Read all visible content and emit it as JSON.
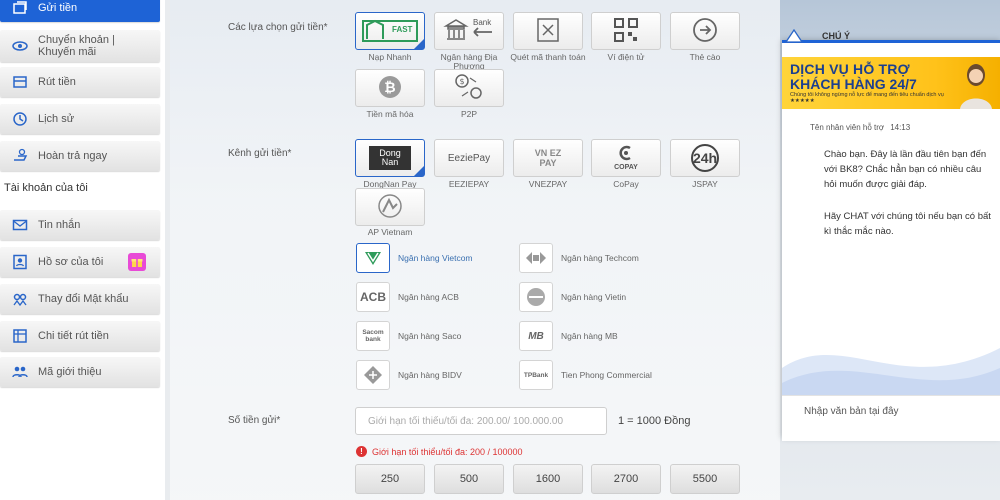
{
  "sidebar": {
    "items": [
      {
        "label": "Gửi tiền",
        "icon": "deposit-icon"
      },
      {
        "label": "Chuyển khoản | Khuyến mãi",
        "icon": "transfer-icon"
      },
      {
        "label": "Rút tiền",
        "icon": "withdraw-icon"
      },
      {
        "label": "Lịch sử",
        "icon": "history-icon"
      },
      {
        "label": "Hoàn trả ngay",
        "icon": "refund-icon"
      }
    ],
    "section_title": "Tài khoản của tôi",
    "account_items": [
      {
        "label": "Tin nhắn",
        "icon": "mail-icon"
      },
      {
        "label": "Hồ sơ của tôi",
        "icon": "profile-icon"
      },
      {
        "label": "Thay đổi Mật khẩu",
        "icon": "key-icon"
      },
      {
        "label": "Chi tiết rút tiền",
        "icon": "withdraw-details-icon"
      },
      {
        "label": "Mã giới thiệu",
        "icon": "referral-icon"
      }
    ]
  },
  "deposit": {
    "options_label": "Các lựa chọn gửi tiền*",
    "options": [
      {
        "label": "Nạp Nhanh",
        "logo": "FAST"
      },
      {
        "label": "Ngân hàng Địa Phương",
        "logo": "Bank"
      },
      {
        "label": "Quét mã thanh toán",
        "logo": ""
      },
      {
        "label": "Ví điện tử",
        "logo": ""
      },
      {
        "label": "Thẻ cào",
        "logo": ""
      },
      {
        "label": "Tiền mã hóa",
        "logo": ""
      },
      {
        "label": "P2P",
        "logo": ""
      }
    ],
    "channel_label": "Kênh gửi tiền*",
    "channels": [
      {
        "label": "DongNan Pay",
        "logo": "Dong Nan"
      },
      {
        "label": "EEZIEPAY",
        "logo": "EeziePay"
      },
      {
        "label": "VNEZPAY",
        "logo": "VN EZ PAY"
      },
      {
        "label": "CoPay",
        "logo": "COPAY"
      },
      {
        "label": "JSPAY",
        "logo": "24h"
      },
      {
        "label": "AP Vietnam",
        "logo": ""
      }
    ],
    "banks": [
      {
        "label": "Ngân hàng Vietcom",
        "logo": ""
      },
      {
        "label": "Ngân hàng Techcom",
        "logo": ""
      },
      {
        "label": "Ngân hàng ACB",
        "logo": "ACB"
      },
      {
        "label": "Ngân hàng Vietin",
        "logo": ""
      },
      {
        "label": "Ngân hàng Saco",
        "logo": "Sacom bank"
      },
      {
        "label": "Ngân hàng MB",
        "logo": "MB"
      },
      {
        "label": "Ngân hàng BIDV",
        "logo": ""
      },
      {
        "label": "Tien Phong Commercial",
        "logo": "TPBank"
      }
    ],
    "amount_label": "Số tiền gửi*",
    "amount_placeholder": "Giới hạn tối thiểu/tối đa: 200.00/ 100.000.00",
    "rate_text": "1 = 1000 Đồng",
    "limit_error": "Giới hạn tối thiểu/tối đa: 200 / 100000",
    "quick_amounts": [
      "250",
      "500",
      "1600",
      "2700",
      "5500"
    ]
  },
  "chat": {
    "title": "CHÚ Ý",
    "banner_line1": "DỊCH VỤ HỖ TRỢ",
    "banner_line2": "KHÁCH HÀNG 24/7",
    "banner_sub": "Chúng tôi không ngừng nỗ lực để mang đến tiêu chuẩn dịch vụ ★★★★★",
    "agent_name": "Tên nhân viên hỗ trợ",
    "agent_time": "14:13",
    "message1": "Chào bạn. Đây là lần đầu tiên bạn đến với BK8? Chắc hẳn bạn có nhiều câu hỏi muốn được giải đáp.",
    "message2": "Hãy CHAT với chúng tôi nếu bạn có bất kì thắc mắc nào.",
    "input_placeholder": "Nhập văn bản tại đây"
  },
  "colors": {
    "primary": "#1e63d6",
    "error": "#dd3333",
    "banner": "#ffc21a"
  }
}
